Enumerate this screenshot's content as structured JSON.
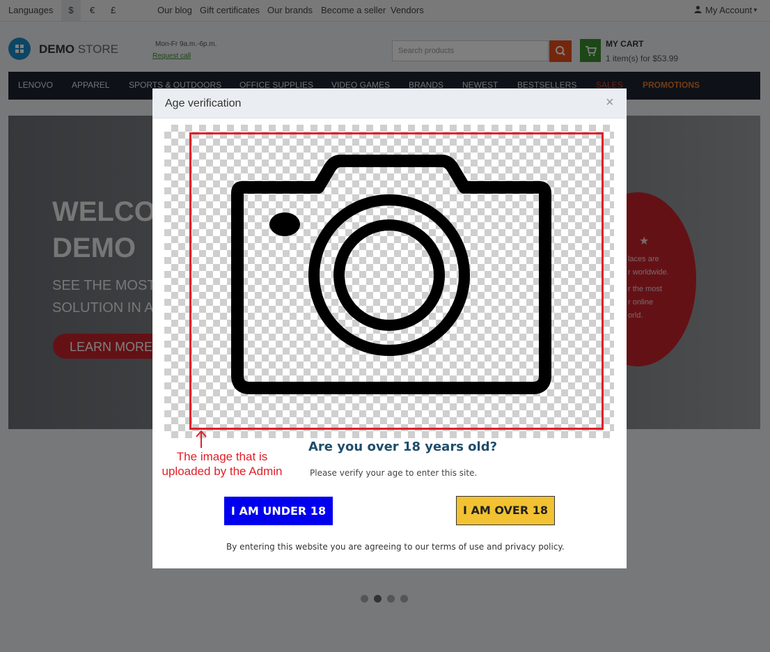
{
  "topbar": {
    "languages": "Languages",
    "currencies": [
      "$",
      "€",
      "£"
    ],
    "links": [
      "Our blog",
      "Gift certificates",
      "Our brands",
      "Become a seller",
      "Vendors"
    ],
    "account": "My Account"
  },
  "header": {
    "logo_bold": "DEMO",
    "logo_light": "STORE",
    "hours": "Mon-Fr 9a.m.-6p.m.",
    "request_call": "Request call",
    "search_placeholder": "Search products",
    "cart_title": "MY CART",
    "cart_summary": "1 item(s) for $53.99"
  },
  "nav": {
    "items": [
      "LENOVO",
      "APPAREL",
      "SPORTS & OUTDOORS",
      "OFFICE SUPPLIES",
      "VIDEO GAMES",
      "BRANDS",
      "NEWEST",
      "BESTSELLERS",
      "SALES",
      "PROMOTIONS"
    ]
  },
  "banner": {
    "title_line1": "WELCO",
    "title_line2": "DEMO",
    "sub_line1": "SEE THE MOST",
    "sub_line2": "SOLUTION IN A",
    "button": "LEARN MORE",
    "circle_lines": [
      "laces are",
      "r worldwide.",
      "r the most",
      "r online",
      "orld."
    ]
  },
  "modal": {
    "title": "Age verification",
    "close": "×",
    "question": "Are you over 18 years old?",
    "verify_text": "Please verify your age to enter this site.",
    "under_button": "I AM UNDER 18",
    "over_button": "I AM OVER 18",
    "terms": "By entering this website you are agreeing to our terms of use and privacy policy."
  },
  "annotation": {
    "line1": "The image that is",
    "line2": "uploaded by the Admin"
  },
  "colors": {
    "accent_red": "#e0202a",
    "under_blue": "#0000ee",
    "over_yellow": "#f2c232",
    "question_blue": "#1f4d6b"
  }
}
